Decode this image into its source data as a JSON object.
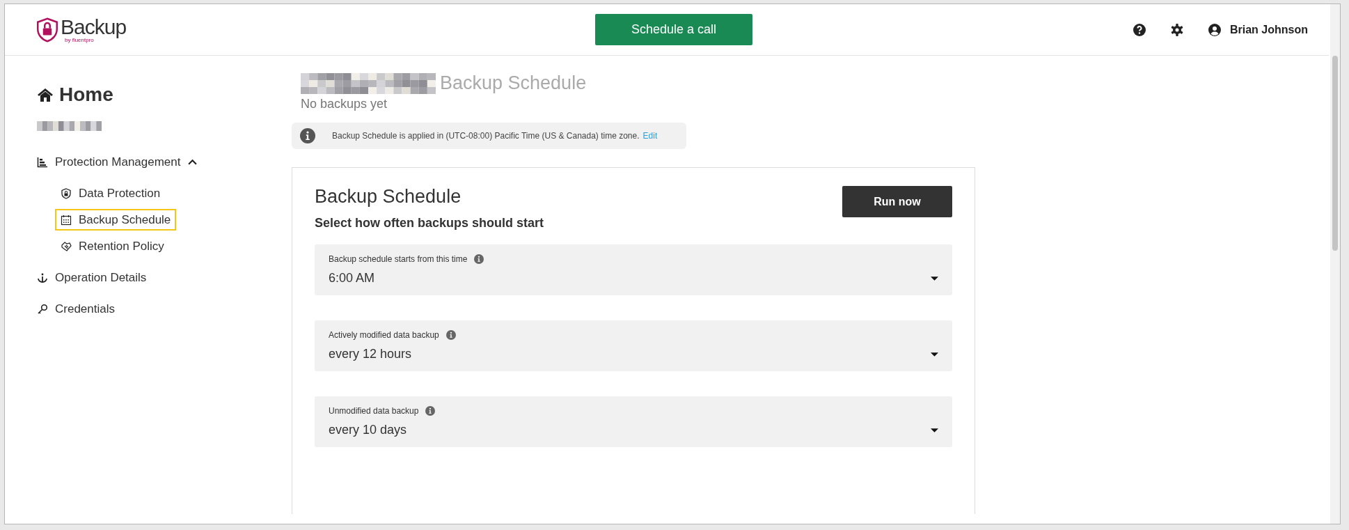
{
  "header": {
    "logo_text": "Backup",
    "logo_subtitle": "by fluentpro",
    "cta": "Schedule a call",
    "user_name": "Brian Johnson"
  },
  "sidebar": {
    "title": "Home",
    "items": [
      {
        "label": "Protection Management",
        "expanded": true,
        "children": [
          {
            "label": "Data Protection",
            "selected": false
          },
          {
            "label": "Backup Schedule",
            "selected": true
          },
          {
            "label": "Retention Policy",
            "selected": false
          }
        ]
      },
      {
        "label": "Operation Details"
      },
      {
        "label": "Credentials"
      }
    ]
  },
  "page": {
    "title": "Backup Schedule",
    "subtitle": "No backups yet",
    "notice": "Backup Schedule is applied in (UTC-08:00) Pacific Time (US & Canada) time zone.",
    "notice_link": "Edit"
  },
  "card": {
    "title": "Backup Schedule",
    "run_button": "Run now",
    "prompt": "Select how often backups should start",
    "fields": [
      {
        "label": "Backup schedule starts from this time",
        "value": "6:00 AM"
      },
      {
        "label": "Actively modified data backup",
        "value": "every 12 hours"
      },
      {
        "label": "Unmodified data backup",
        "value": "every 10 days"
      }
    ]
  }
}
